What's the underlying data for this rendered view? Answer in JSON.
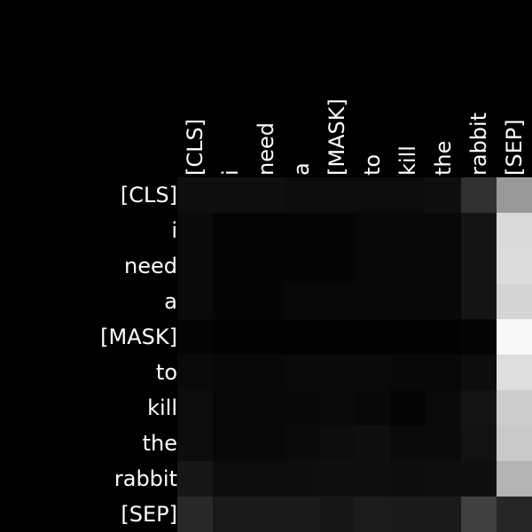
{
  "chart_data": {
    "type": "heatmap",
    "x_tokens": [
      "[CLS]",
      "i",
      "need",
      "a",
      "[MASK]",
      "to",
      "kill",
      "the",
      "rabbit",
      "[SEP]"
    ],
    "y_tokens": [
      "[CLS]",
      "i",
      "need",
      "a",
      "[MASK]",
      "to",
      "kill",
      "the",
      "rabbit",
      "[SEP]"
    ],
    "colormap": "gray",
    "value_range": [
      0,
      1
    ],
    "values": [
      [
        0.06,
        0.06,
        0.06,
        0.05,
        0.05,
        0.05,
        0.05,
        0.06,
        0.19,
        0.6
      ],
      [
        0.04,
        0.02,
        0.02,
        0.02,
        0.02,
        0.03,
        0.03,
        0.03,
        0.08,
        0.85
      ],
      [
        0.04,
        0.02,
        0.02,
        0.02,
        0.02,
        0.03,
        0.03,
        0.03,
        0.08,
        0.86
      ],
      [
        0.04,
        0.02,
        0.02,
        0.03,
        0.03,
        0.03,
        0.03,
        0.03,
        0.08,
        0.83
      ],
      [
        0.02,
        0.01,
        0.01,
        0.01,
        0.01,
        0.01,
        0.01,
        0.01,
        0.02,
        0.97
      ],
      [
        0.04,
        0.03,
        0.03,
        0.04,
        0.04,
        0.04,
        0.03,
        0.03,
        0.05,
        0.87
      ],
      [
        0.05,
        0.03,
        0.03,
        0.03,
        0.04,
        0.03,
        0.02,
        0.04,
        0.08,
        0.8
      ],
      [
        0.05,
        0.03,
        0.03,
        0.04,
        0.05,
        0.06,
        0.04,
        0.04,
        0.07,
        0.79
      ],
      [
        0.09,
        0.05,
        0.05,
        0.05,
        0.06,
        0.06,
        0.05,
        0.06,
        0.06,
        0.7
      ],
      [
        0.16,
        0.1,
        0.1,
        0.1,
        0.09,
        0.11,
        0.1,
        0.1,
        0.25,
        0.15
      ]
    ]
  }
}
